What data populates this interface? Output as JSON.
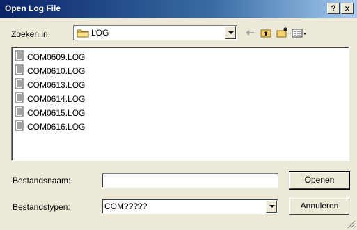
{
  "window": {
    "title": "Open Log File",
    "help_button": "?",
    "close_button": "x"
  },
  "look_in": {
    "label": "Zoeken in:",
    "value": "LOG"
  },
  "toolbar": {
    "icons": [
      "back-icon",
      "up-folder-icon",
      "new-folder-icon",
      "view-menu-icon"
    ]
  },
  "files": [
    "COM0609.LOG",
    "COM0610.LOG",
    "COM0613.LOG",
    "COM0614.LOG",
    "COM0615.LOG",
    "COM0616.LOG"
  ],
  "filename": {
    "label": "Bestandsnaam:",
    "value": ""
  },
  "filetype": {
    "label": "Bestandstypen:",
    "value": "COM?????"
  },
  "buttons": {
    "open": "Openen",
    "cancel": "Annuleren"
  }
}
